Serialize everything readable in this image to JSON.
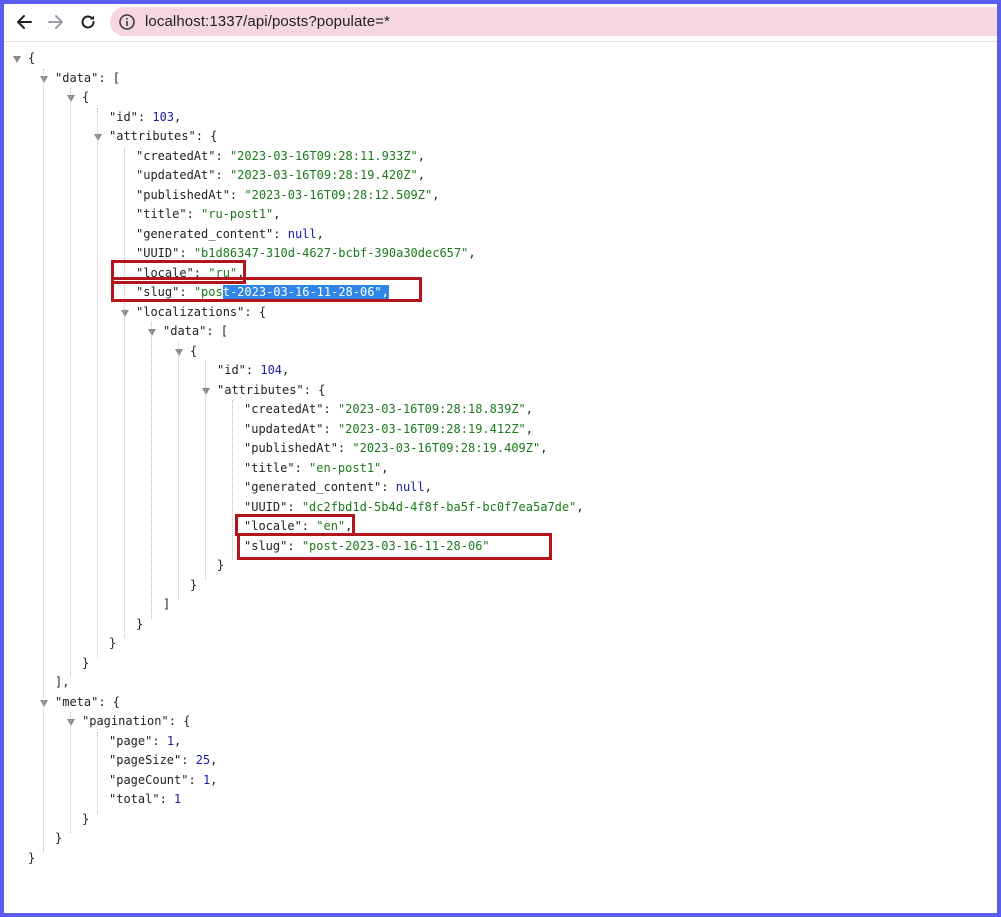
{
  "browser": {
    "url": "localhost:1337/api/posts?populate=*",
    "icons": {
      "back": "arrow-left-icon",
      "forward": "arrow-right-icon",
      "reload": "reload-icon",
      "info": "info-circle-icon"
    }
  },
  "json": {
    "data_key": "\"data\"",
    "meta_key": "\"meta\"",
    "id_key": "\"id\"",
    "attributes_key": "\"attributes\"",
    "localizations_key": "\"localizations\"",
    "pagination_key": "\"pagination\"",
    "item": {
      "id": "103",
      "attributes": [
        {
          "key": "\"createdAt\"",
          "value": "\"2023-03-16T09:28:11.933Z\"",
          "type": "s"
        },
        {
          "key": "\"updatedAt\"",
          "value": "\"2023-03-16T09:28:19.420Z\"",
          "type": "s"
        },
        {
          "key": "\"publishedAt\"",
          "value": "\"2023-03-16T09:28:12.509Z\"",
          "type": "s"
        },
        {
          "key": "\"title\"",
          "value": "\"ru-post1\"",
          "type": "s"
        },
        {
          "key": "\"generated_content\"",
          "value": "null",
          "type": "n"
        },
        {
          "key": "\"UUID\"",
          "value": "\"b1d86347-310d-4627-bcbf-390a30dec657\"",
          "type": "s"
        },
        {
          "key": "\"locale\"",
          "value": "\"ru\"",
          "type": "s"
        }
      ],
      "slug_key": "\"slug\"",
      "slug_value_plain": "\"pos",
      "slug_value_selected": "t-2023-03-16-11-28-06\""
    },
    "localization": {
      "id": "104",
      "attributes": [
        {
          "key": "\"createdAt\"",
          "value": "\"2023-03-16T09:28:18.839Z\"",
          "type": "s"
        },
        {
          "key": "\"updatedAt\"",
          "value": "\"2023-03-16T09:28:19.412Z\"",
          "type": "s"
        },
        {
          "key": "\"publishedAt\"",
          "value": "\"2023-03-16T09:28:19.409Z\"",
          "type": "s"
        },
        {
          "key": "\"title\"",
          "value": "\"en-post1\"",
          "type": "s"
        },
        {
          "key": "\"generated_content\"",
          "value": "null",
          "type": "n"
        },
        {
          "key": "\"UUID\"",
          "value": "\"dc2fbd1d-5b4d-4f8f-ba5f-bc0f7ea5a7de\"",
          "type": "s"
        },
        {
          "key": "\"locale\"",
          "value": "\"en\"",
          "type": "s"
        },
        {
          "key": "\"slug\"",
          "value": "\"post-2023-03-16-11-28-06\"",
          "type": "s"
        }
      ]
    },
    "pagination": [
      {
        "key": "\"page\"",
        "value": "1"
      },
      {
        "key": "\"pageSize\"",
        "value": "25"
      },
      {
        "key": "\"pageCount\"",
        "value": "1"
      },
      {
        "key": "\"total\"",
        "value": "1"
      }
    ]
  },
  "highlight_color": "#b3151c",
  "selection_color": "#2f86e8"
}
